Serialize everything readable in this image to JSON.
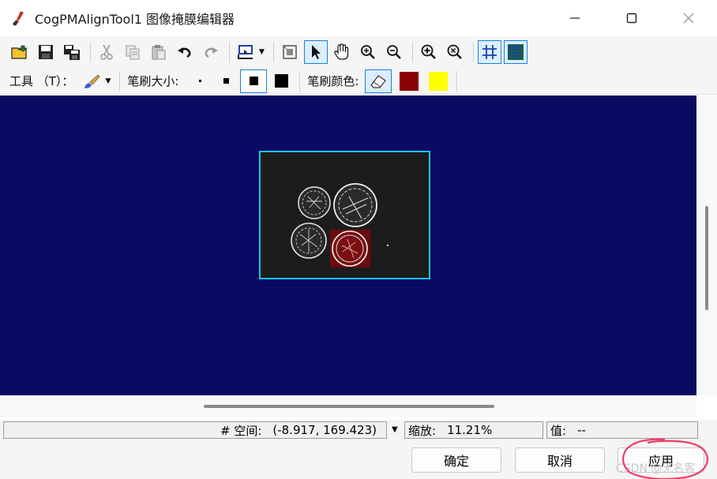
{
  "window": {
    "title": "CogPMAlignTool1 图像掩膜编辑器",
    "icons": [
      "app-icon",
      "minimize-icon",
      "maximize-icon",
      "close-icon"
    ]
  },
  "toolbar": {
    "icons": [
      "open-folder-icon",
      "save-icon",
      "save-all-icon",
      "cut-icon",
      "copy-icon",
      "paste-icon",
      "undo-icon",
      "redo-icon",
      "import-icon",
      "fit-icon",
      "pointer-icon",
      "pan-hand-icon",
      "zoom-in-icon",
      "zoom-out-icon",
      "zoom-in-alt-icon",
      "zoom-reset-icon",
      "grid-icon",
      "grid-fine-icon"
    ]
  },
  "tools_bar": {
    "tool_label": "工具 （T）：",
    "brush_size_label": "笔刷大小:",
    "brush_color_label": "笔刷颜色:",
    "brush_colors": [
      "#8b0000",
      "#ffff00"
    ]
  },
  "canvas": {
    "background": "#0a0a62",
    "frame_color": "#10c8e0"
  },
  "status": {
    "space_label": "# 空间:",
    "coordinates": "(-8.917, 169.423)",
    "zoom_label": "缩放:",
    "zoom_value": "11.21%",
    "value_label": "值:",
    "value_text": "--"
  },
  "buttons": {
    "ok": "确定",
    "cancel": "取消",
    "apply": "应用"
  },
  "watermark": "CSDN @无名客_"
}
